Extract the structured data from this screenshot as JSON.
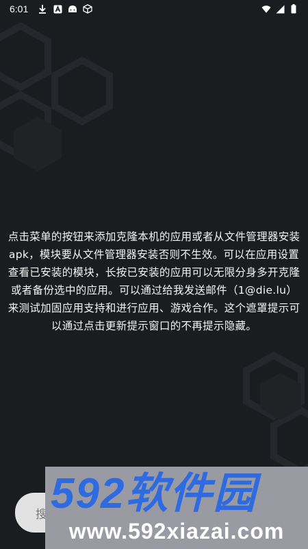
{
  "status_bar": {
    "time": "6:01",
    "left_icons": [
      "download-icon",
      "autofill-icon",
      "android-icon",
      "cube-icon"
    ],
    "right_icons": [
      "wifi-icon",
      "signal-icon",
      "battery-icon"
    ]
  },
  "hint": {
    "text": "点击菜单的按钮来添加克隆本机的应用或者从文件管理器安装apk，模块要从文件管理器安装否则不生效。可以在应用设置查看已安装的模块，长按已安装的应用可以无限分身多开克隆或者备份选中的应用。可以通过给我发送邮件（1@die.lu）来测试加固应用支持和进行应用、游戏合作。这个遮罩提示可以通过点击更新提示窗口的不再提示隐藏。"
  },
  "search": {
    "placeholder": "搜"
  },
  "watermark": {
    "logo_text": "592软件园",
    "url": "www.592xiazai.com",
    "colors": {
      "logo_blue": "#2f6be0",
      "background": "#9a9aa2"
    }
  },
  "colors": {
    "background": "#1b1c20",
    "text": "#ffffff"
  }
}
